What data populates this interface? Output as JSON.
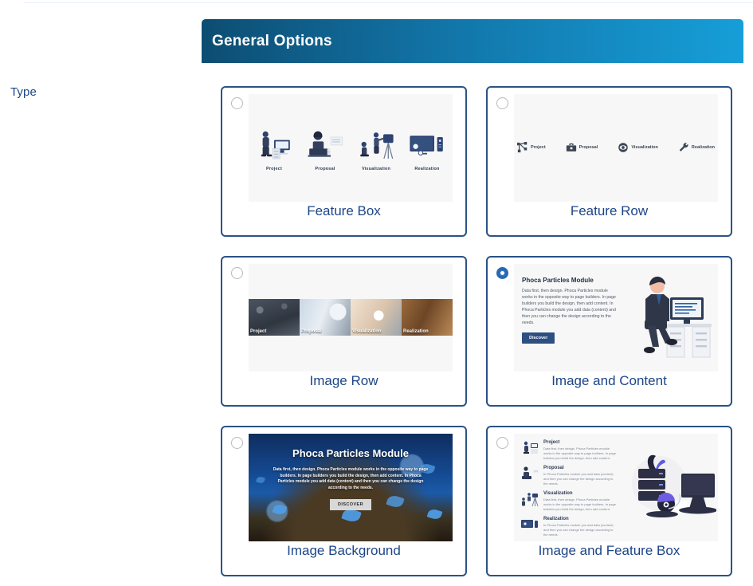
{
  "field": {
    "type_label": "Type"
  },
  "panel": {
    "title": "General Options"
  },
  "options": [
    {
      "id": "feature-box",
      "label": "Feature Box",
      "selected": false
    },
    {
      "id": "feature-row",
      "label": "Feature Row",
      "selected": false
    },
    {
      "id": "image-row",
      "label": "Image Row",
      "selected": false
    },
    {
      "id": "image-and-content",
      "label": "Image and Content",
      "selected": true
    },
    {
      "id": "image-background",
      "label": "Image Background",
      "selected": false
    },
    {
      "id": "image-and-feature-box",
      "label": "Image and Feature Box",
      "selected": false
    }
  ],
  "previews": {
    "feature_box": {
      "items": [
        {
          "caption": "Project"
        },
        {
          "caption": "Proposal"
        },
        {
          "caption": "Visualization"
        },
        {
          "caption": "Realization"
        }
      ]
    },
    "feature_row": {
      "items": [
        {
          "caption": "Project",
          "icon": "sitemap-icon"
        },
        {
          "caption": "Proposal",
          "icon": "briefcase-icon"
        },
        {
          "caption": "Visualization",
          "icon": "eye-icon"
        },
        {
          "caption": "Realization",
          "icon": "wrench-icon"
        }
      ]
    },
    "image_row": {
      "items": [
        {
          "caption": "Project"
        },
        {
          "caption": "Proposal"
        },
        {
          "caption": "Visualization"
        },
        {
          "caption": "Realization"
        }
      ]
    },
    "image_and_content": {
      "heading": "Phoca Particles Module",
      "body": "Data first, then design. Phoca Particles module works in the opposite way to page builders. In page builders you build the design, then add content. In Phoca Particles module you add data (content) and then you can change the design according to the needs.",
      "button": "Discover"
    },
    "image_background": {
      "heading": "Phoca Particles Module",
      "body": "Data first, then design. Phoca Particles module works in the opposite way to page builders. In page builders you build the design, then add content. In Phoca Particles module you add data (content) and then you can change the design according to the needs.",
      "button": "DISCOVER"
    },
    "image_and_feature_box": {
      "items": [
        {
          "heading": "Project",
          "body": "Data first, then design. Phoca Particles module works in the opposite way to page builders. In page builders you build the design, then add content."
        },
        {
          "heading": "Proposal",
          "body": "In Phoca Particles module you add data (content) and then you can change the design according to the needs."
        },
        {
          "heading": "Visualization",
          "body": "Data first, then design. Phoca Particles module works in the opposite way to page builders. In page builders you build the design, then add content."
        },
        {
          "heading": "Realization",
          "body": "In Phoca Particles module you add data (content) and then you can change the design according to the needs."
        }
      ]
    }
  },
  "colors": {
    "header_gradient_start": "#0d4d72",
    "header_gradient_end": "#169ed8",
    "card_border": "#2b5286",
    "label_text": "#1c4587",
    "radio_selected": "#2769b3",
    "preview_bg": "#f7f7f7"
  }
}
